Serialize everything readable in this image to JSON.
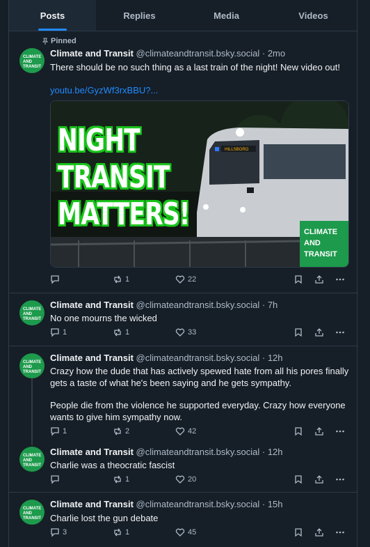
{
  "tabs": [
    "Posts",
    "Replies",
    "Media",
    "Videos"
  ],
  "pinned_label": "Pinned",
  "posts": [
    {
      "name": "Climate and Transit",
      "handle": "@climateandtransit.bsky.social",
      "time": "· 2mo",
      "text": "There should be no such thing as a last train of the night! New video out!",
      "link": "youtu.be/GyzWf3rxBBU?...",
      "replies": "",
      "reposts": "1",
      "likes": "22"
    },
    {
      "name": "Climate and Transit",
      "handle": "@climateandtransit.bsky.social",
      "time": "· 7h",
      "text": "No one mourns the wicked",
      "replies": "1",
      "reposts": "1",
      "likes": "33"
    },
    {
      "name": "Climate and Transit",
      "handle": "@climateandtransit.bsky.social",
      "time": "· 12h",
      "text": "Crazy how the dude that has actively spewed hate from all his pores finally gets a taste of what he's been saying and he gets sympathy.",
      "text2": "People die from the violence he supported everyday. Crazy how everyone wants to give him sympathy now.",
      "replies": "1",
      "reposts": "2",
      "likes": "42"
    },
    {
      "name": "Climate and Transit",
      "handle": "@climateandtransit.bsky.social",
      "time": "· 12h",
      "text": "Charlie was a theocratic fascist",
      "replies": "",
      "reposts": "1",
      "likes": "20"
    },
    {
      "name": "Climate and Transit",
      "handle": "@climateandtransit.bsky.social",
      "time": "· 15h",
      "text": "Charlie lost the gun debate",
      "replies": "3",
      "reposts": "1",
      "likes": "45"
    }
  ],
  "thumbnail": {
    "lines": [
      "NIGHT",
      "TRANSIT",
      "MATTERS!"
    ],
    "logo": [
      "CLIMATE",
      "AND",
      "TRANSIT"
    ],
    "destination_sign": "HILLSBORO"
  },
  "avatar_text": [
    "CLIMATE",
    "AND",
    "TRANSIT"
  ],
  "colors": {
    "background": "#161e27",
    "accent": "#208bfe",
    "brand_green": "#1d9a4c",
    "muted": "#aebbc9"
  }
}
